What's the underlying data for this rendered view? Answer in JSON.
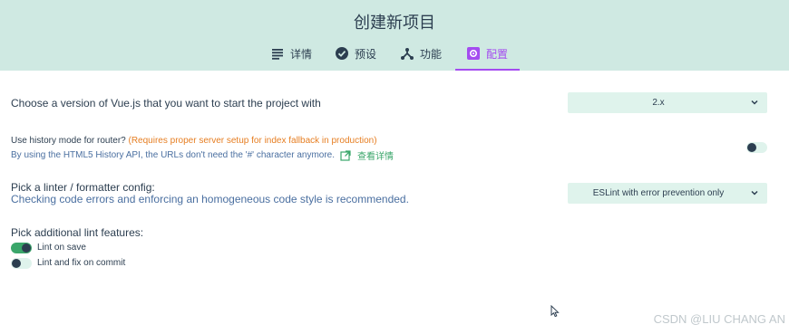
{
  "header": {
    "title": "创建新项目",
    "tabs": [
      {
        "label": "详情",
        "icon": "list-icon",
        "active": false
      },
      {
        "label": "预设",
        "icon": "check-circle-icon",
        "active": false
      },
      {
        "label": "功能",
        "icon": "fork-icon",
        "active": false
      },
      {
        "label": "配置",
        "icon": "settings-icon",
        "active": true
      }
    ]
  },
  "config": {
    "vue_version": {
      "label": "Choose a version of Vue.js that you want to start the project with",
      "value": "2.x"
    },
    "history": {
      "label": "Use history mode for router?",
      "warning": "(Requires proper server setup for index fallback in production)",
      "description": "By using the HTML5 History API, the URLs don't need the '#' character anymore.",
      "link": "查看详情",
      "enabled": false
    },
    "linter": {
      "label": "Pick a linter / formatter config:",
      "description": "Checking code errors and enforcing an homogeneous code style is recommended.",
      "value": "ESLint with error prevention only"
    },
    "lint_features": {
      "label": "Pick additional lint features:",
      "options": [
        {
          "label": "Lint on save",
          "enabled": true
        },
        {
          "label": "Lint and fix on commit",
          "enabled": false
        }
      ]
    }
  },
  "watermark": "CSDN @LIU CHANG AN",
  "colors": {
    "header_bg": "#cfe9e2",
    "accent": "#a44cf0",
    "green": "#3aa66a",
    "warning": "#e67e22",
    "control_bg": "#dff3ec"
  }
}
